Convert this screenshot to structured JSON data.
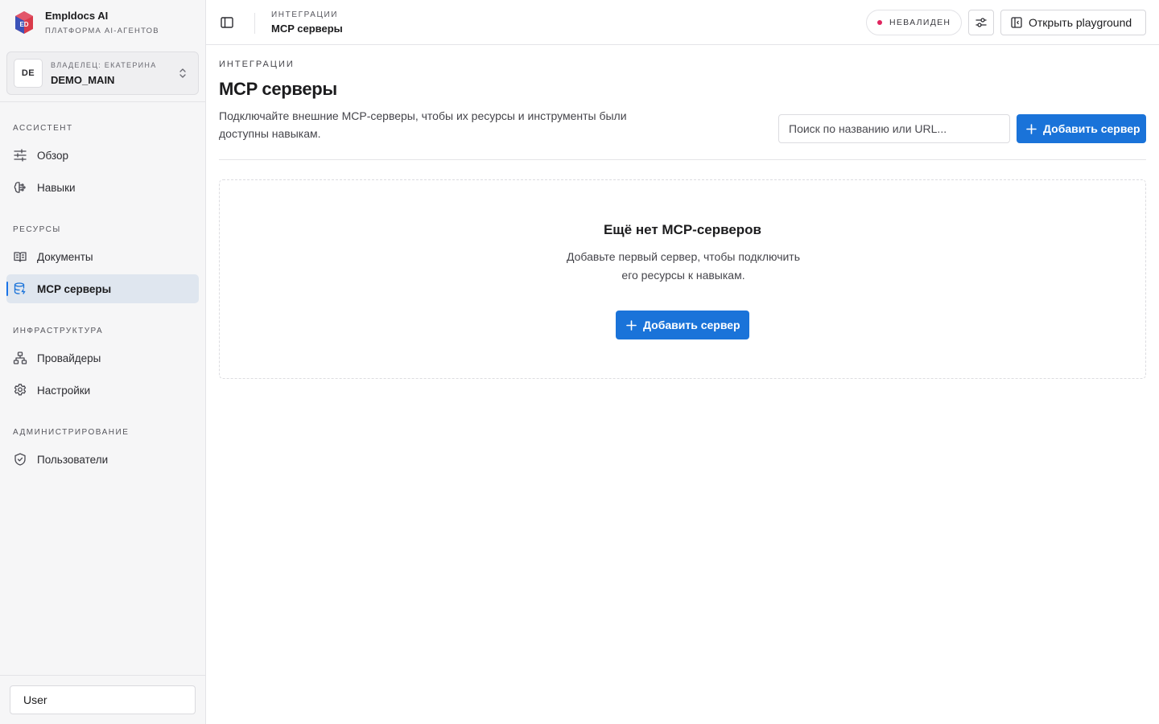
{
  "brand": {
    "name": "Empldocs AI",
    "subtitle": "ПЛАТФОРМА AI-АГЕНТОВ"
  },
  "workspace": {
    "initials": "DE",
    "owner": "ВЛАДЕЛЕЦ: ЕКАТЕРИНА",
    "name": "DEMO_MAIN"
  },
  "sidebar": {
    "sections": [
      {
        "label": "АССИСТЕНТ",
        "items": [
          {
            "label": "Обзор",
            "icon": "sliders-icon"
          },
          {
            "label": "Навыки",
            "icon": "brain-icon"
          }
        ]
      },
      {
        "label": "РЕСУРСЫ",
        "items": [
          {
            "label": "Документы",
            "icon": "book-icon"
          },
          {
            "label": "MCP серверы",
            "icon": "database-icon",
            "active": true
          }
        ]
      },
      {
        "label": "ИНФРАСТРУКТУРА",
        "items": [
          {
            "label": "Провайдеры",
            "icon": "network-icon"
          },
          {
            "label": "Настройки",
            "icon": "gear-icon"
          }
        ]
      },
      {
        "label": "АДМИНИСТРИРОВАНИЕ",
        "items": [
          {
            "label": "Пользователи",
            "icon": "shield-icon"
          }
        ]
      }
    ],
    "user": "User"
  },
  "header": {
    "breadcrumb_section": "ИНТЕГРАЦИИ",
    "breadcrumb_title": "MCP серверы",
    "status": "НЕВАЛИДЕН",
    "playground": "Открыть playground"
  },
  "main": {
    "eyebrow": "ИНТЕГРАЦИИ",
    "title": "MCP серверы",
    "description": "Подключайте внешние MCP-серверы, чтобы их ресурсы и инструменты были доступны навыкам.",
    "search_placeholder": "Поиск по названию или URL...",
    "search_value": "",
    "add_button": "Добавить сервер",
    "empty": {
      "title": "Ещё нет MCP-серверов",
      "description": "Добавьте первый сервер, чтобы подключить его ресурсы к навыкам.",
      "button": "Добавить сервер"
    }
  },
  "colors": {
    "accent": "#1a73d9",
    "status_dot": "#e0245e",
    "active_nav_bg": "#dfe6ef"
  }
}
